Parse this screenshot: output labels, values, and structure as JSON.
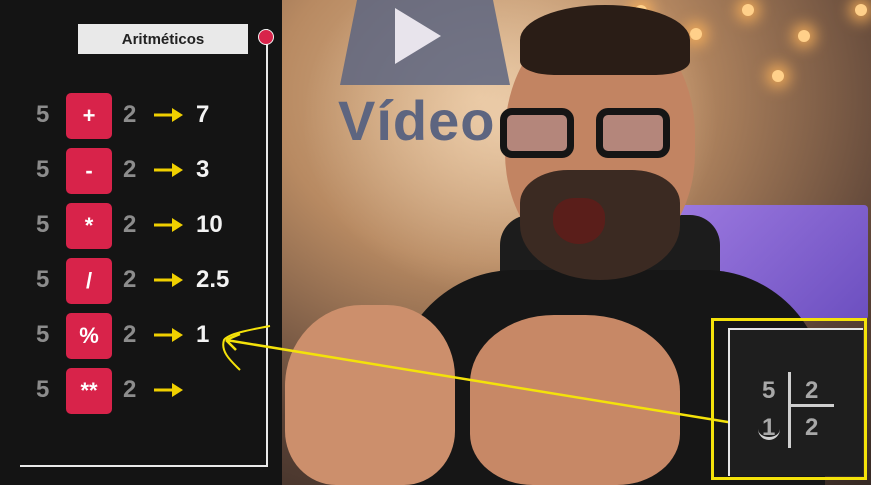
{
  "scene": {
    "wall_text": "Vídeo"
  },
  "panel": {
    "title": "Aritméticos",
    "rows": [
      {
        "left": "5",
        "op": "+",
        "right": "2",
        "result": "7"
      },
      {
        "left": "5",
        "op": "-",
        "right": "2",
        "result": "3"
      },
      {
        "left": "5",
        "op": "*",
        "right": "2",
        "result": "10"
      },
      {
        "left": "5",
        "op": "/",
        "right": "2",
        "result": "2.5"
      },
      {
        "left": "5",
        "op": "%",
        "right": "2",
        "result": "1"
      },
      {
        "left": "5",
        "op": "**",
        "right": "2",
        "result": ""
      }
    ]
  },
  "inset": {
    "dividend": "5",
    "divisor": "2",
    "remainder": "1",
    "quotient": "2"
  },
  "colors": {
    "accent_red": "#d8234a",
    "highlight_yellow": "#f4e20a",
    "arrow_yellow": "#f0d000"
  },
  "icons": {
    "arrow": "arrow-right-icon",
    "status_dot": "red-dot-icon"
  }
}
